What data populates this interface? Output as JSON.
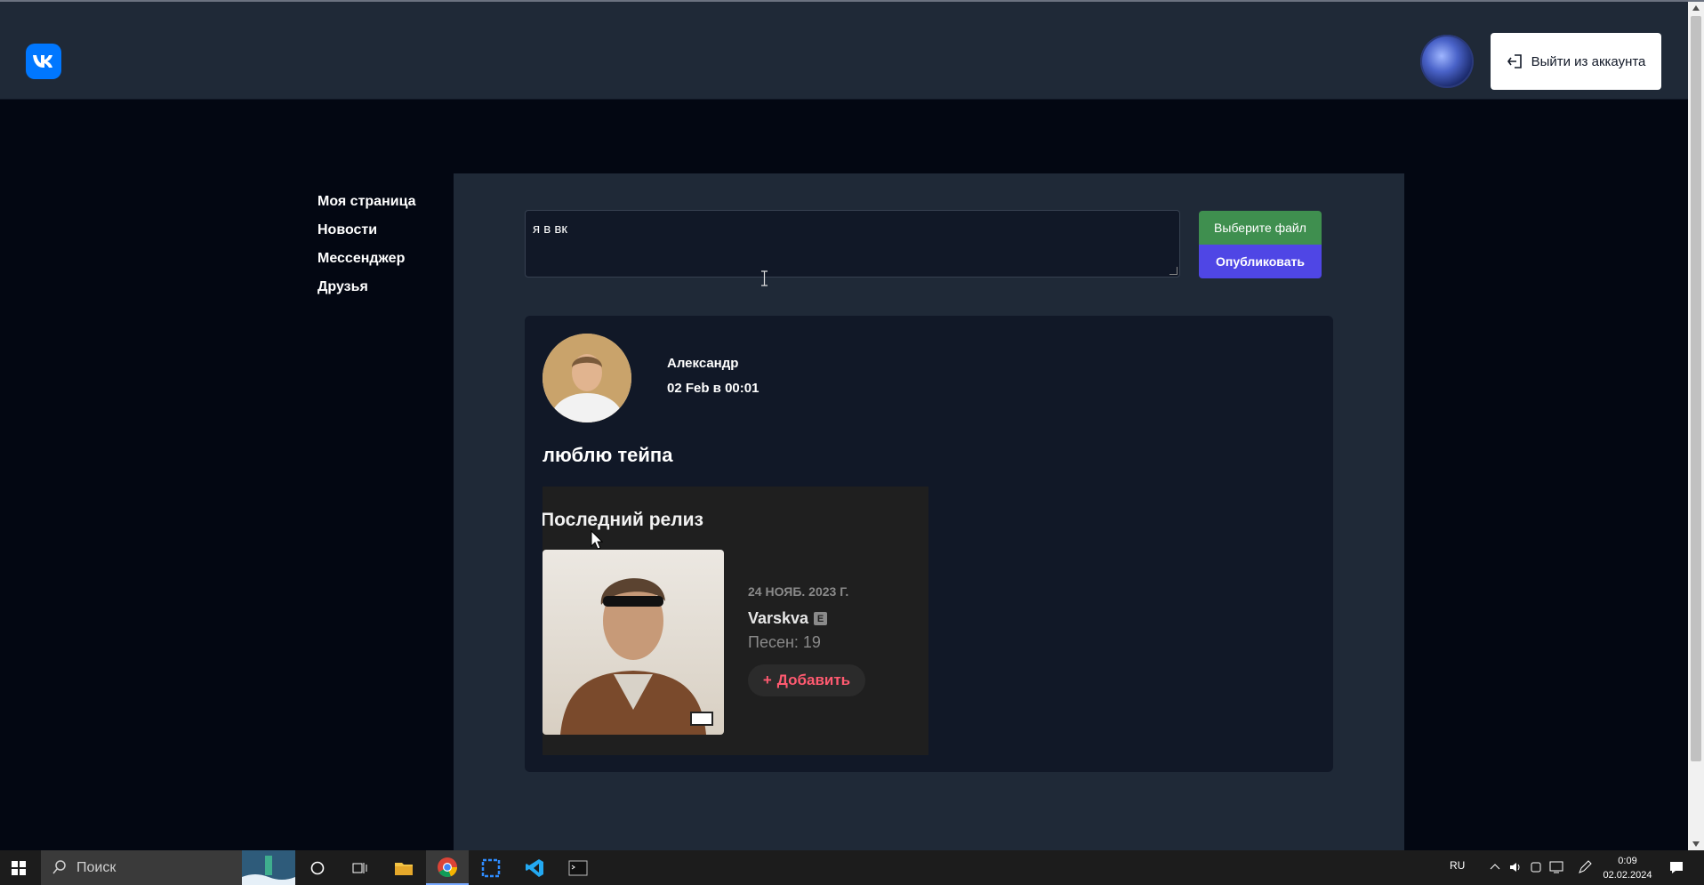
{
  "header": {
    "logo_icon": "vk-logo-icon",
    "logout_label": "Выйти из аккаунта"
  },
  "nav": {
    "items": [
      {
        "label": "Моя страница"
      },
      {
        "label": "Новости"
      },
      {
        "label": "Мессенджер"
      },
      {
        "label": "Друзья"
      }
    ]
  },
  "composer": {
    "value": "я в вк",
    "file_button": "Выберите файл",
    "publish_button": "Опубликовать"
  },
  "post": {
    "author": "Александр",
    "date": "02 Feb в 00:01",
    "text": "люблю тейпа",
    "image": {
      "heading": "Последний релиз",
      "release_date": "24 НОЯБ. 2023 Г.",
      "title": "Varskva",
      "explicit": "E",
      "songs": "Песен: 19",
      "add_label": "Добавить"
    }
  },
  "taskbar": {
    "search_placeholder": "Поиск",
    "language": "RU",
    "time": "0:09",
    "date": "02.02.2024"
  },
  "colors": {
    "page_bg": "#030712",
    "panel_bg": "#1f2937",
    "card_bg": "#111827",
    "vk_blue": "#0077ff",
    "file_button": "#3f8f4f",
    "publish_button": "#4f46e5"
  }
}
